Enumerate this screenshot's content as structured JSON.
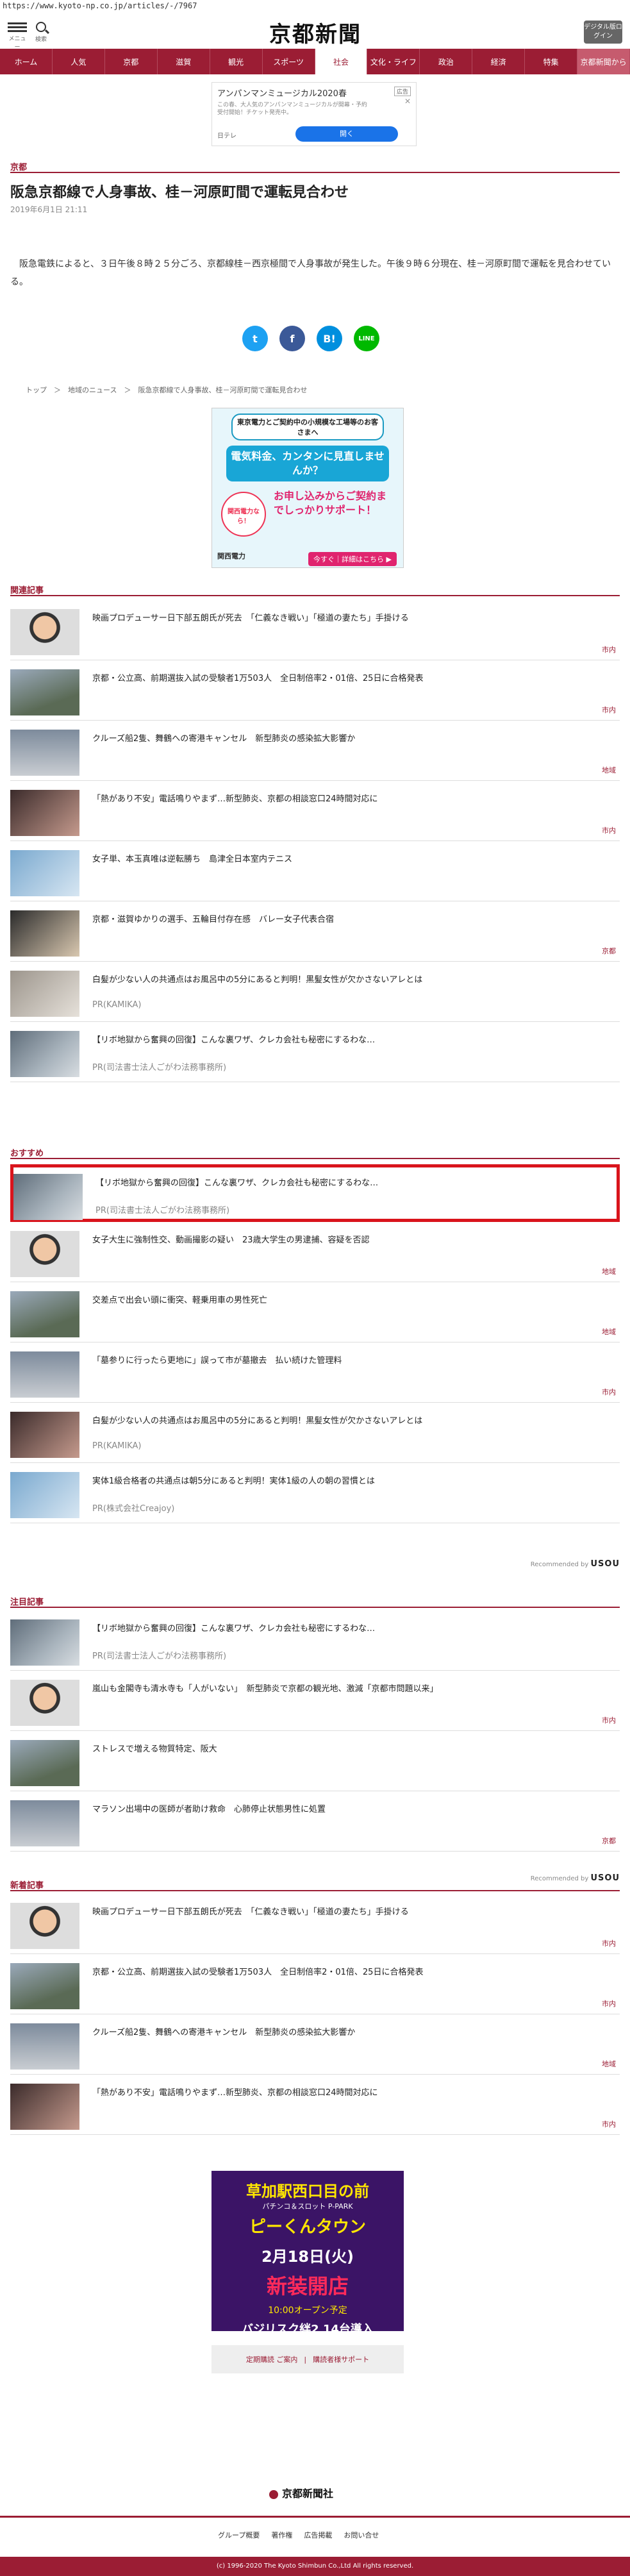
{
  "url": "https://www.kyoto-np.co.jp/articles/-/7967",
  "header": {
    "menu_label": "メニュー",
    "search_label": "検索",
    "logo": "京都新聞",
    "digital_btn": "デジタル版ログイン"
  },
  "nav": [
    "ホーム",
    "人気",
    "京都",
    "滋賀",
    "観光",
    "スポーツ",
    "社会",
    "文化・ライフ",
    "政治",
    "経済",
    "特集",
    "京都新聞から"
  ],
  "nav_active": "社会",
  "ad1": {
    "badge": "広告",
    "title": "アンパンマンミュージカル2020春",
    "desc": "この春、大人気のアンパンマンミュージカルが開幕・予約受付開始！チケット発売中。",
    "domain": "日テレ",
    "open": "開く"
  },
  "article": {
    "category": "京都",
    "title": "阪急京都線で人身事故、桂－河原町間で運転見合わせ",
    "date": "2019年6月1日 21:11",
    "body": "阪急電鉄によると、３日午後８時２５分ごろ、京都線桂－西京極間で人身事故が発生した。午後９時６分現在、桂－河原町間で運転を見合わせている。"
  },
  "share": [
    "t",
    "f",
    "B!",
    "LINE"
  ],
  "breadcrumb": "トップ　＞　地域のニュース　＞　阪急京都線で人身事故、桂－河原町間で運転見合わせ",
  "ad2": {
    "head": "東京電力とご契約中の小規模な工場等のお客さまへ",
    "big": "電気料金、カンタンに見直しませんか？",
    "man": "関西電力なら！",
    "red": "お申し込みからご契約までしっかりサポート！",
    "logo": "関西電力",
    "cta": "今すぐ｜詳細はこちら ▶"
  },
  "sections": {
    "related": "関連記事",
    "recommend": "おすすめ",
    "featured": "注目記事",
    "latest": "新着記事"
  },
  "related": [
    {
      "title": "映画プロデューサー日下部五朗氏が死去　「仁義なき戦い」「極道の妻たち」手掛ける",
      "cat": "市内"
    },
    {
      "title": "京都・公立高、前期選抜入試の受験者1万503人　全日制倍率2・01倍、25日に合格発表",
      "cat": "市内"
    },
    {
      "title": "クルーズ船2隻、舞鶴への寄港キャンセル　新型肺炎の感染拡大影響か",
      "cat": "地域"
    },
    {
      "title": "「熱があり不安」電話鳴りやまず…新型肺炎、京都の相談窓口24時間対応に",
      "cat": "市内"
    },
    {
      "title": "女子単、本玉真唯は逆転勝ち　島津全日本室内テニス",
      "cat": ""
    },
    {
      "title": "京都・滋賀ゆかりの選手、五輪目付存在感　バレー女子代表合宿",
      "cat": "京都"
    },
    {
      "title": "白髪が少ない人の共通点はお風呂中の5分にあると判明！黒髪女性が欠かさないアレとは",
      "pr": "PR(KAMIKA)"
    },
    {
      "title": "【リボ地獄から奮興の回復】こんな裏ワザ、クレカ会社も秘密にするわな…",
      "pr": "PR(司法書士法人ごがわ法務事務所)"
    }
  ],
  "recommend": [
    {
      "title": "【リボ地獄から奮興の回復】こんな裏ワザ、クレカ会社も秘密にするわな…",
      "pr": "PR(司法書士法人ごがわ法務事務所)"
    },
    {
      "title": "女子大生に強制性交、動画撮影の疑い　23歳大学生の男逮捕、容疑を否認",
      "cat": "地域"
    },
    {
      "title": "交差点で出会い頭に衝突、軽乗用車の男性死亡",
      "cat": "地域"
    },
    {
      "title": "「墓参りに行ったら更地に」誤って市が墓撤去　払い続けた管理料",
      "cat": "市内"
    },
    {
      "title": "白髪が少ない人の共通点はお風呂中の5分にあると判明！黒髪女性が欠かさないアレとは",
      "pr": "PR(KAMIKA)"
    },
    {
      "title": "実体1級合格者の共通点は朝5分にあると判明！実体1級の人の朝の習慣とは",
      "pr": "PR(株式会社Creajoy)"
    }
  ],
  "reco_label": "Recommended by",
  "reco_brand": "USOU",
  "featured": [
    {
      "title": "【リボ地獄から奮興の回復】こんな裏ワザ、クレカ会社も秘密にするわな…",
      "pr": "PR(司法書士法人ごがわ法務事務所)"
    },
    {
      "title": "嵐山も金閣寺も清水寺も「人がいない」　新型肺炎で京都の観光地、激減「京都市問題以来」",
      "cat": "市内"
    },
    {
      "title": "ストレスで増える物質特定、阪大",
      "cat": ""
    },
    {
      "title": "マラソン出場中の医師が者助け救命　心肺停止状態男性に処置",
      "cat": "京都"
    }
  ],
  "latest": [
    {
      "title": "映画プロデューサー日下部五朗氏が死去　「仁義なき戦い」「極道の妻たち」手掛ける",
      "cat": "市内"
    },
    {
      "title": "京都・公立高、前期選抜入試の受験者1万503人　全日制倍率2・01倍、25日に合格発表",
      "cat": "市内"
    },
    {
      "title": "クルーズ船2隻、舞鶴への寄港キャンセル　新型肺炎の感染拡大影響か",
      "cat": "地域"
    },
    {
      "title": "「熱があり不安」電話鳴りやまず…新型肺炎、京都の相談窓口24時間対応に",
      "cat": "市内"
    }
  ],
  "ad3": {
    "a": "草加駅西口目の前",
    "b": "パチンコ＆スロット P-PARK",
    "c": "ピーくんタウン",
    "d": "2月18日(火)",
    "e": "新装開店",
    "f": "10:00オープン予定",
    "g": "バジリスク絆2 14台導入"
  },
  "links": [
    "定期購読 ご案内",
    "購読者様サポート"
  ],
  "footer": {
    "logo": "京都新聞社",
    "links": [
      "グループ概要",
      "著作権",
      "広告掲載",
      "お問い合せ"
    ],
    "copyright": "(c) 1996-2020 The Kyoto Shimbun Co.,Ltd All rights reserved."
  }
}
